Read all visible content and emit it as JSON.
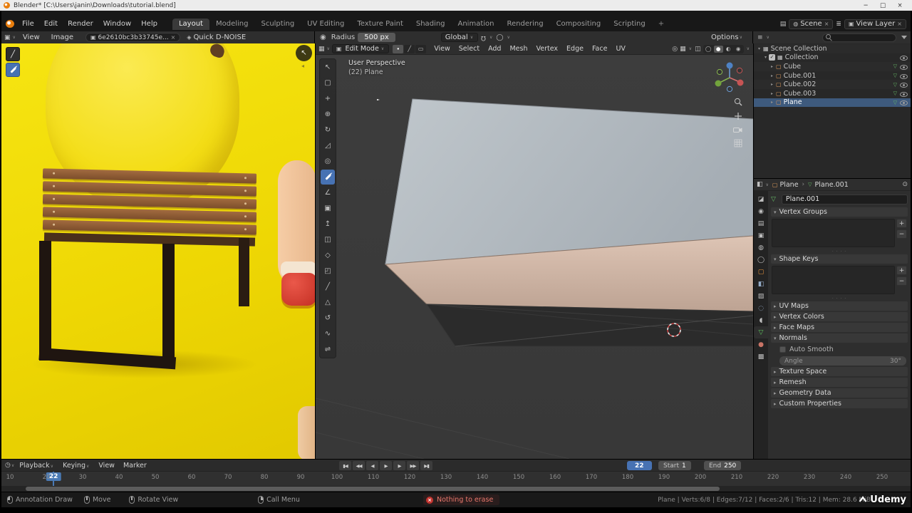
{
  "titlebar": {
    "title": "Blender* [C:\\Users\\janin\\Downloads\\tutorial.blend]",
    "minimize": "─",
    "maximize": "□",
    "close": "×"
  },
  "topbar": {
    "menus": [
      "File",
      "Edit",
      "Render",
      "Window",
      "Help"
    ],
    "workspaces": [
      "Layout",
      "Modeling",
      "Sculpting",
      "UV Editing",
      "Texture Paint",
      "Shading",
      "Animation",
      "Rendering",
      "Compositing",
      "Scripting"
    ],
    "active_workspace": "Layout",
    "add_workspace": "+",
    "scene": "Scene",
    "view_layer": "View Layer"
  },
  "image_editor": {
    "menu_view": "View",
    "menu_image": "Image",
    "datablock": "6e2610bc3b33745e...",
    "quick_dnoise": "Quick D-NOISE"
  },
  "tool_settings": {
    "radius_label": "Radius",
    "radius_value": "500 px",
    "orientation": "Global",
    "options": "Options"
  },
  "viewport": {
    "mode": "Edit Mode",
    "menus": [
      "View",
      "Select",
      "Add",
      "Mesh",
      "Vertex",
      "Edge",
      "Face",
      "UV"
    ],
    "overlay_perspective": "User Perspective",
    "overlay_object": "(22) Plane"
  },
  "toolbar": {
    "tools": [
      "select-tweak",
      "select-box",
      "cursor",
      "move",
      "rotate",
      "scale",
      "transform",
      "annotate",
      "measure",
      "add-cube",
      "extrude-region",
      "inset-faces",
      "bevel",
      "loop-cut",
      "knife",
      "poly-build",
      "spin",
      "smooth",
      "edge-slide"
    ],
    "active": "annotate"
  },
  "outliner": {
    "rows": [
      {
        "label": "Scene Collection",
        "depth": 0,
        "type": "collection-scene",
        "selected": false
      },
      {
        "label": "Collection",
        "depth": 1,
        "type": "collection",
        "selected": false
      },
      {
        "label": "Cube",
        "depth": 2,
        "type": "mesh",
        "selected": false
      },
      {
        "label": "Cube.001",
        "depth": 2,
        "type": "mesh",
        "selected": false
      },
      {
        "label": "Cube.002",
        "depth": 2,
        "type": "mesh",
        "selected": false
      },
      {
        "label": "Cube.003",
        "depth": 2,
        "type": "mesh",
        "selected": false
      },
      {
        "label": "Plane",
        "depth": 2,
        "type": "mesh",
        "selected": true
      }
    ]
  },
  "properties": {
    "tabs": [
      "tool",
      "render",
      "output",
      "view-layer",
      "scene",
      "world",
      "object",
      "modifiers",
      "particles",
      "physics",
      "constraints",
      "object-data",
      "material",
      "texture"
    ],
    "active_tab": "object-data",
    "breadcrumb_object": "Plane",
    "breadcrumb_data": "Plane.001",
    "name_field": "Plane.001",
    "panels": [
      {
        "label": "Vertex Groups",
        "expanded": true,
        "kind": "list"
      },
      {
        "label": "Shape Keys",
        "expanded": true,
        "kind": "list"
      },
      {
        "label": "UV Maps",
        "expanded": false
      },
      {
        "label": "Vertex Colors",
        "expanded": false
      },
      {
        "label": "Face Maps",
        "expanded": false
      },
      {
        "label": "Normals",
        "expanded": true,
        "kind": "normals"
      },
      {
        "label": "Texture Space",
        "expanded": false
      },
      {
        "label": "Remesh",
        "expanded": false
      },
      {
        "label": "Geometry Data",
        "expanded": false
      },
      {
        "label": "Custom Properties",
        "expanded": false
      }
    ],
    "auto_smooth": "Auto Smooth",
    "angle_label": "Angle",
    "angle_value": "30°"
  },
  "timeline": {
    "menus": [
      "Playback",
      "Keying",
      "View",
      "Marker"
    ],
    "transport": [
      "jump-start",
      "prev-keyframe",
      "prev-frame",
      "play",
      "next-frame",
      "next-keyframe",
      "jump-end"
    ],
    "current_frame": "22",
    "start_label": "Start",
    "start_value": "1",
    "end_label": "End",
    "end_value": "250",
    "ticks": [
      "10",
      "20",
      "30",
      "40",
      "50",
      "60",
      "70",
      "80",
      "90",
      "100",
      "110",
      "120",
      "130",
      "140",
      "150",
      "160",
      "170",
      "180",
      "190",
      "200",
      "210",
      "220",
      "230",
      "240",
      "250"
    ]
  },
  "statusbar": {
    "hints": [
      "Annotation Draw",
      "Move",
      "Rotate View",
      "Call Menu"
    ],
    "error": "Nothing to erase",
    "stats": "Plane | Verts:6/8 | Edges:7/12 | Faces:2/6 | Tris:12 | Mem: 28.6 MiB",
    "watermark": "Udemy"
  },
  "colors": {
    "accent_blue": "#4772b3",
    "selected_row": "#3e5a7d",
    "error_red": "#c3342f",
    "image_yellow": "#eed704"
  }
}
